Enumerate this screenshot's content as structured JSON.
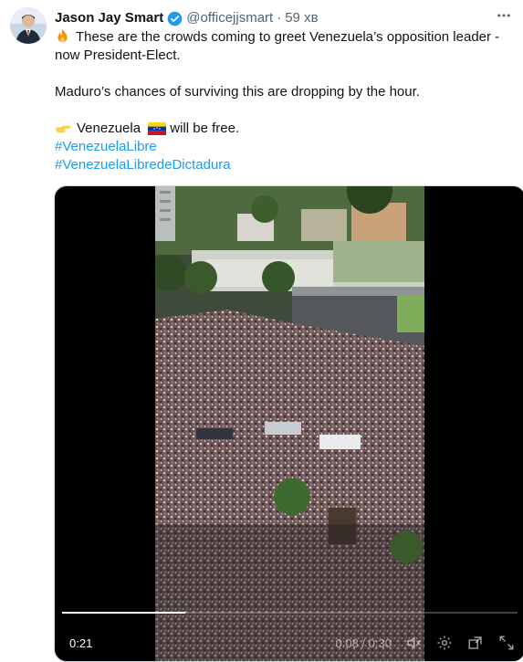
{
  "author": {
    "name": "Jason Jay Smart",
    "handle": "@officejjsmart",
    "separator": "·",
    "time": "59 хв"
  },
  "tweet": {
    "line1": "These are the crowds coming to greet Venezuela’s opposition leader -",
    "line2": "now President-Elect.",
    "line3": "Maduro’s chances of surviving this are dropping by the hour.",
    "line4_before": "Venezuela",
    "line4_after": "will be free.",
    "hashtags": [
      "#VenezuelaLibre",
      "#VenezuelaLibredeDictadura"
    ],
    "icons": {
      "lead": "fire-icon",
      "pointer": "pointing-hand-icon",
      "flag": "venezuela-flag-icon"
    }
  },
  "video": {
    "elapsed": "0:21",
    "timecode": "0:08 / 0:30",
    "progress": 0.27,
    "icons": [
      "volume-icon",
      "settings-icon",
      "popout-icon",
      "fullscreen-icon"
    ]
  },
  "colors": {
    "link": "#1d9bf0",
    "verified": "#1d9bf0",
    "secondary": "#536471"
  }
}
